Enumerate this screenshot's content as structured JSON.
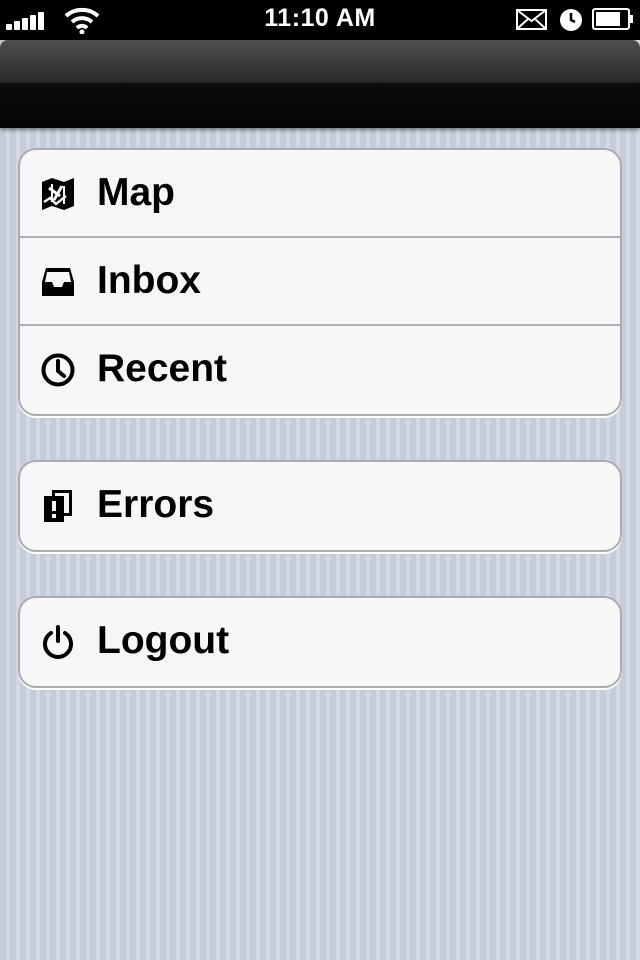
{
  "status_bar": {
    "time": "11:10 AM",
    "icons": [
      "signal-icon",
      "wifi-icon",
      "mail-icon",
      "alarm-icon",
      "battery-icon"
    ]
  },
  "nav_bar": {
    "title": ""
  },
  "menu": {
    "groups": [
      {
        "items": [
          {
            "label": "Map",
            "icon": "map-icon"
          },
          {
            "label": "Inbox",
            "icon": "inbox-icon"
          },
          {
            "label": "Recent",
            "icon": "clock-icon"
          }
        ]
      },
      {
        "items": [
          {
            "label": "Errors",
            "icon": "error-document-icon"
          }
        ]
      },
      {
        "items": [
          {
            "label": "Logout",
            "icon": "power-icon"
          }
        ]
      }
    ]
  },
  "colors": {
    "background": "#cbd2dc",
    "cell_background": "#f7f7f7",
    "cell_border": "#a9acb1",
    "nav_bar": "#0b0b0b"
  }
}
